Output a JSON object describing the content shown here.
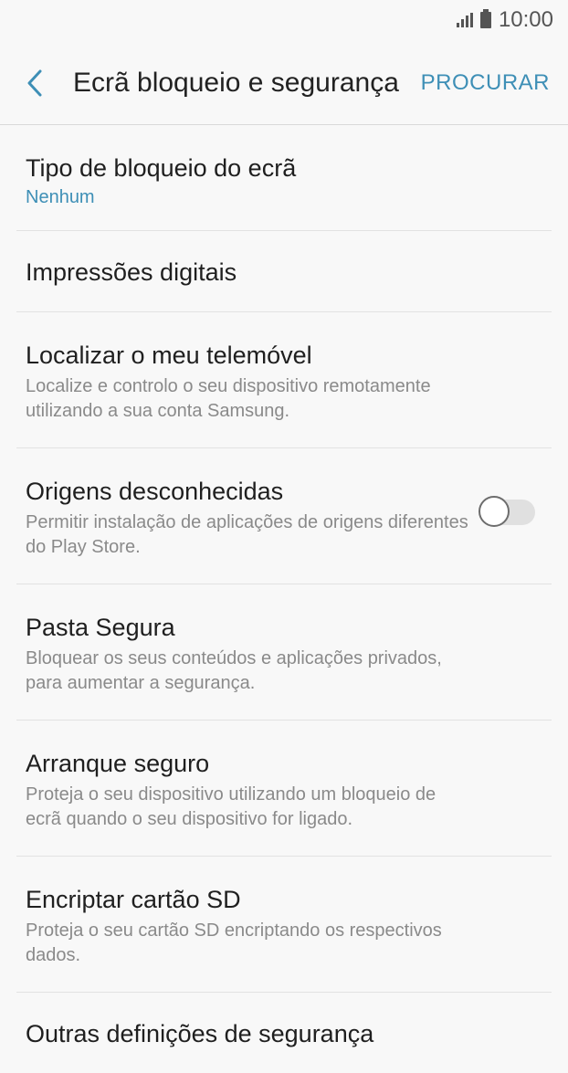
{
  "status_bar": {
    "time": "10:00"
  },
  "header": {
    "title": "Ecrã bloqueio e segurança",
    "search_label": "PROCURAR"
  },
  "items": [
    {
      "label": "Tipo de bloqueio do ecrã",
      "value": "Nenhum"
    },
    {
      "label": "Impressões digitais"
    },
    {
      "label": "Localizar o meu telemóvel",
      "desc": "Localize e controlo o seu dispositivo remotamente utilizando a sua conta Samsung."
    },
    {
      "label": "Origens desconhecidas",
      "desc": "Permitir instalação de aplicações de origens diferentes do Play Store.",
      "toggle_on": false
    },
    {
      "label": "Pasta Segura",
      "desc": "Bloquear os seus conteúdos e aplicações privados, para aumentar a segurança."
    },
    {
      "label": "Arranque seguro",
      "desc": "Proteja o seu dispositivo utilizando um bloqueio de ecrã quando o seu dispositivo for ligado."
    },
    {
      "label": "Encriptar cartão SD",
      "desc": "Proteja o seu cartão SD encriptando os respectivos dados."
    },
    {
      "label": "Outras definições de segurança"
    }
  ],
  "colors": {
    "accent": "#3e8fb6",
    "background": "#f8f8f8"
  }
}
